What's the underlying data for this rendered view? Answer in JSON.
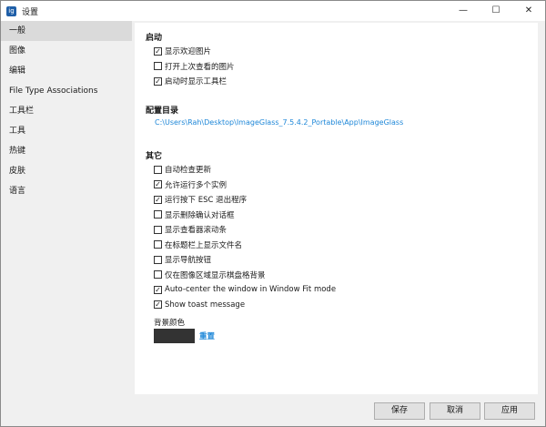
{
  "window": {
    "title": "设置",
    "minimize": "—",
    "maximize": "☐",
    "close": "✕"
  },
  "sidebar": {
    "items": [
      {
        "label": "一般",
        "active": true
      },
      {
        "label": "图像"
      },
      {
        "label": "编辑"
      },
      {
        "label": "File Type Associations"
      },
      {
        "label": "工具栏"
      },
      {
        "label": "工具"
      },
      {
        "label": "热键"
      },
      {
        "label": "皮肤"
      },
      {
        "label": "语言"
      }
    ]
  },
  "startup": {
    "title": "启动",
    "options": [
      {
        "label": "显示欢迎图片",
        "checked": true
      },
      {
        "label": "打开上次查看的图片",
        "checked": false
      },
      {
        "label": "启动时显示工具栏",
        "checked": true
      }
    ]
  },
  "config": {
    "title": "配置目录",
    "path": "C:\\Users\\Rah\\Desktop\\ImageGlass_7.5.4.2_Portable\\App\\ImageGlass"
  },
  "other": {
    "title": "其它",
    "options": [
      {
        "label": "自动检查更新",
        "checked": false
      },
      {
        "label": "允许运行多个实例",
        "checked": true
      },
      {
        "label": "运行按下 ESC 退出程序",
        "checked": true
      },
      {
        "label": "显示删除确认对话框",
        "checked": false
      },
      {
        "label": "显示查看器滚动条",
        "checked": false
      },
      {
        "label": "在标题栏上显示文件名",
        "checked": false
      },
      {
        "label": "显示导航按钮",
        "checked": false
      },
      {
        "label": "仅在图像区域显示棋盘格背景",
        "checked": false
      },
      {
        "label": "Auto-center the window in Window Fit mode",
        "checked": true
      },
      {
        "label": "Show toast message",
        "checked": true
      }
    ]
  },
  "background": {
    "label": "背景颜色",
    "color": "#333333",
    "reset": "重置"
  },
  "footer": {
    "save": "保存",
    "cancel": "取消",
    "apply": "应用"
  },
  "colors": {
    "link": "#1e87d8"
  }
}
